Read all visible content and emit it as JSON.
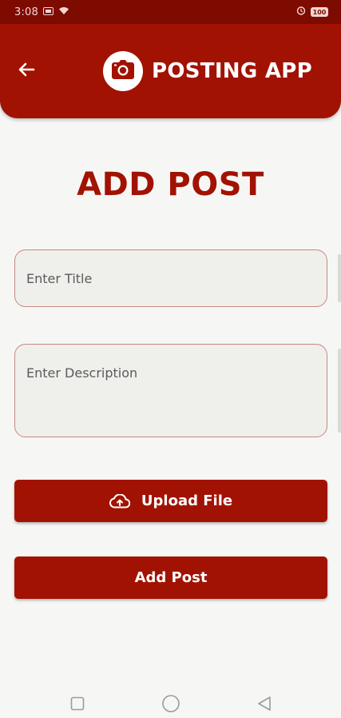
{
  "status_bar": {
    "time": "3:08",
    "battery": "100"
  },
  "app_bar": {
    "title": "POSTING APP",
    "back_icon": "arrow-left-icon",
    "logo_icon": "camera-icon"
  },
  "page": {
    "title": "ADD POST"
  },
  "form": {
    "title_placeholder": "Enter Title",
    "title_value": "",
    "description_placeholder": "Enter Description",
    "description_value": "",
    "upload_label": "Upload File",
    "upload_icon": "cloud-upload-icon",
    "submit_label": "Add Post"
  },
  "nav_bar": {
    "icons": [
      "recent-apps-icon",
      "home-icon",
      "back-icon"
    ]
  },
  "colors": {
    "primary": "#a21203",
    "status_bar": "#7e0b00",
    "background": "#f6f7f5",
    "field_background": "#efefec",
    "field_border": "#c9877f"
  }
}
